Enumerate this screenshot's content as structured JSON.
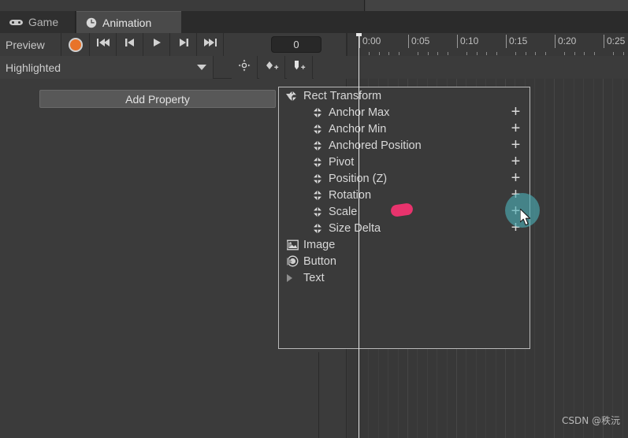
{
  "window": {
    "title": "Unity Animation Window"
  },
  "tabs": [
    {
      "label": "Game",
      "icon": "gamepad-icon",
      "active": false
    },
    {
      "label": "Animation",
      "icon": "clock-icon",
      "active": true
    }
  ],
  "toolbar": {
    "preview_label": "Preview",
    "record_button": "record-button",
    "playback_buttons": [
      {
        "name": "first-frame-button",
        "icon": "skip-to-start-icon"
      },
      {
        "name": "previous-frame-button",
        "icon": "step-back-icon"
      },
      {
        "name": "play-button",
        "icon": "play-icon"
      },
      {
        "name": "next-frame-button",
        "icon": "step-forward-icon"
      },
      {
        "name": "last-frame-button",
        "icon": "skip-to-end-icon"
      }
    ],
    "frame_field_value": "0",
    "frame_field_placeholder": "0"
  },
  "clip_selector": {
    "selected": "Highlighted",
    "chevron": "chevron-down-icon"
  },
  "keyframe_toolbar": [
    {
      "name": "filter-target-button",
      "icon": "target-icon"
    },
    {
      "name": "add-keyframe-button",
      "icon": "diamond-plus-icon"
    },
    {
      "name": "add-event-button",
      "icon": "marker-plus-icon"
    }
  ],
  "left_pane": {
    "add_property_label": "Add Property"
  },
  "property_popup": {
    "rows": [
      {
        "label": "Rect Transform",
        "depth": 0,
        "icon": "move-petals-icon",
        "fold": "open",
        "plus": false
      },
      {
        "label": "Anchor Max",
        "depth": 1,
        "icon": "move-petals-icon",
        "fold": "none",
        "plus": true,
        "plus_label": "+"
      },
      {
        "label": "Anchor Min",
        "depth": 1,
        "icon": "move-petals-icon",
        "fold": "none",
        "plus": true,
        "plus_label": "+"
      },
      {
        "label": "Anchored Position",
        "depth": 1,
        "icon": "move-petals-icon",
        "fold": "none",
        "plus": true,
        "plus_label": "+"
      },
      {
        "label": "Pivot",
        "depth": 1,
        "icon": "move-petals-icon",
        "fold": "none",
        "plus": true,
        "plus_label": "+"
      },
      {
        "label": "Position (Z)",
        "depth": 1,
        "icon": "move-petals-icon",
        "fold": "none",
        "plus": true,
        "plus_label": "+"
      },
      {
        "label": "Rotation",
        "depth": 1,
        "icon": "move-petals-icon",
        "fold": "none",
        "plus": true,
        "plus_label": "+"
      },
      {
        "label": "Scale",
        "depth": 1,
        "icon": "move-petals-icon",
        "fold": "none",
        "plus": true,
        "plus_label": "+"
      },
      {
        "label": "Size Delta",
        "depth": 1,
        "icon": "move-petals-icon",
        "fold": "none",
        "plus": true,
        "plus_label": "+"
      },
      {
        "label": "Image",
        "depth": 0,
        "icon": "image-icon",
        "fold": "closed",
        "plus": false
      },
      {
        "label": "Button",
        "depth": 0,
        "icon": "button-circle-icon",
        "fold": "closed",
        "plus": false
      },
      {
        "label": "Text",
        "depth": 0,
        "icon": "none",
        "fold": "closed",
        "plus": false
      }
    ]
  },
  "timeline": {
    "tick_labels": [
      "0:00",
      "0:05",
      "0:10",
      "0:15",
      "0:20",
      "0:25"
    ],
    "tick_x": [
      15,
      77,
      139,
      201,
      263,
      325
    ],
    "playhead_position": "0:00",
    "minor_ticks_per_major": 5
  },
  "annotations": {
    "highlight_blob_color": "#e8336d",
    "cursor_highlight_color": "#4cb0b8",
    "cursor": "mouse-pointer-icon"
  },
  "watermark": {
    "text": "CSDN @秩沅"
  },
  "colors": {
    "background": "#3b3b3b",
    "panel": "#383838",
    "tab_active": "#4a4a4a",
    "record_accent": "#e8732a",
    "popup_border": "#b9b9b9"
  }
}
